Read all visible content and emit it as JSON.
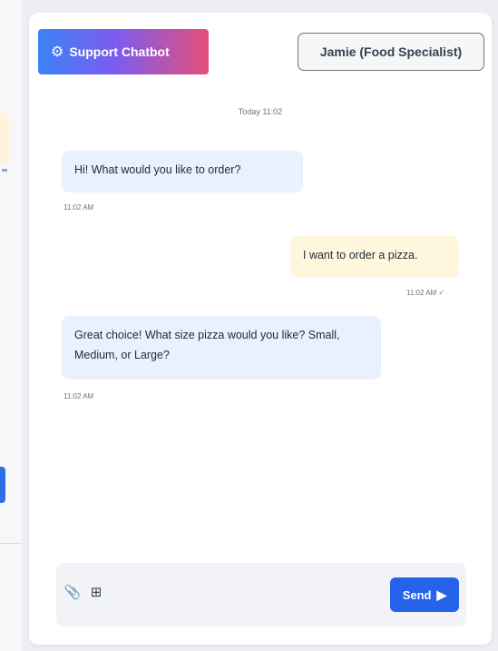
{
  "header": {
    "brand_icon": "⚙",
    "brand_label": "Support Chatbot",
    "agent_label": "Jamie (Food Specialist)"
  },
  "chat": {
    "divider": "Today 11:02",
    "messages": [
      {
        "role": "bot",
        "text": "Hi! What would you like to order?",
        "time": "11:02 AM"
      },
      {
        "role": "user",
        "text": "I want to order a pizza.",
        "time": "11:02 AM ✓"
      },
      {
        "role": "bot",
        "text": "Great choice! What size pizza would you like? Small, Medium, or Large?",
        "time": "11:02 AM"
      }
    ]
  },
  "composer": {
    "attach_icon": "📎",
    "image_icon": "⊞",
    "placeholder": "",
    "send_label": "Send",
    "send_icon": "▶"
  },
  "colors": {
    "brand_gradient": [
      "#3b82f6",
      "#7c5cf0",
      "#e44f7a"
    ],
    "bot_bubble": "#eaf1fe",
    "user_bubble": "#fff6de",
    "send_button": "#2563eb"
  }
}
